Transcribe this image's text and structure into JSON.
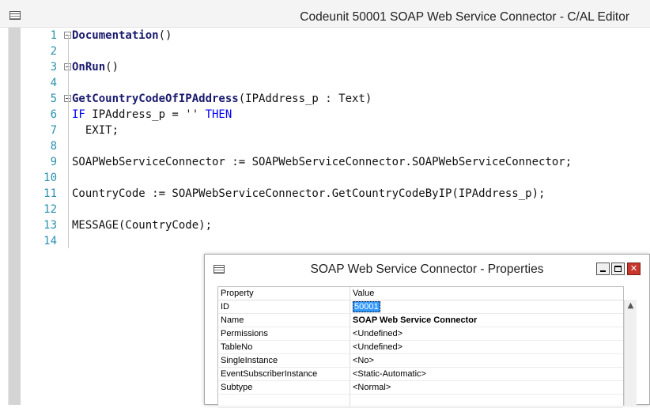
{
  "editor": {
    "title": "Codeunit 50001 SOAP Web Service Connector - C/AL Editor",
    "lines": [
      {
        "num": "1",
        "fold": true,
        "parts": [
          {
            "t": "Documentation",
            "c": "trig"
          },
          {
            "t": "()",
            "c": ""
          }
        ]
      },
      {
        "num": "2",
        "fold": false,
        "parts": []
      },
      {
        "num": "3",
        "fold": true,
        "parts": [
          {
            "t": "OnRun",
            "c": "trig"
          },
          {
            "t": "()",
            "c": ""
          }
        ]
      },
      {
        "num": "4",
        "fold": false,
        "parts": []
      },
      {
        "num": "5",
        "fold": true,
        "parts": [
          {
            "t": "GetCountryCodeOfIPAddress",
            "c": "trig"
          },
          {
            "t": "(IPAddress_p : Text)",
            "c": ""
          }
        ]
      },
      {
        "num": "6",
        "fold": false,
        "parts": [
          {
            "t": "IF",
            "c": "kw"
          },
          {
            "t": " IPAddress_p = '' ",
            "c": ""
          },
          {
            "t": "THEN",
            "c": "kw"
          }
        ]
      },
      {
        "num": "7",
        "fold": false,
        "parts": [
          {
            "t": "  EXIT;",
            "c": ""
          }
        ]
      },
      {
        "num": "8",
        "fold": false,
        "parts": []
      },
      {
        "num": "9",
        "fold": false,
        "parts": [
          {
            "t": "SOAPWebServiceConnector := SOAPWebServiceConnector.SOAPWebServiceConnector;",
            "c": ""
          }
        ]
      },
      {
        "num": "10",
        "fold": false,
        "parts": []
      },
      {
        "num": "11",
        "fold": false,
        "parts": [
          {
            "t": "CountryCode := SOAPWebServiceConnector.GetCountryCodeByIP(IPAddress_p);",
            "c": ""
          }
        ]
      },
      {
        "num": "12",
        "fold": false,
        "parts": []
      },
      {
        "num": "13",
        "fold": false,
        "parts": [
          {
            "t": "MESSAGE(CountryCode);",
            "c": ""
          }
        ]
      },
      {
        "num": "14",
        "fold": false,
        "parts": []
      }
    ]
  },
  "properties": {
    "title": "SOAP Web Service Connector - Properties",
    "col_property": "Property",
    "col_value": "Value",
    "close_glyph": "✕",
    "rows": [
      {
        "name": "ID",
        "value": "50001",
        "style": "sel"
      },
      {
        "name": "Name",
        "value": "SOAP Web Service Connector",
        "style": "bold"
      },
      {
        "name": "Permissions",
        "value": "<Undefined>",
        "style": ""
      },
      {
        "name": "TableNo",
        "value": "<Undefined>",
        "style": ""
      },
      {
        "name": "SingleInstance",
        "value": "<No>",
        "style": ""
      },
      {
        "name": "EventSubscriberInstance",
        "value": "<Static-Automatic>",
        "style": ""
      },
      {
        "name": "Subtype",
        "value": "<Normal>",
        "style": ""
      },
      {
        "name": "",
        "value": "",
        "style": ""
      }
    ],
    "scroll_up_glyph": "▲"
  },
  "colors": {
    "line_number": "#2b91af",
    "keyword": "#0000ff",
    "selection": "#3399ff",
    "close_button": "#c7372b"
  }
}
